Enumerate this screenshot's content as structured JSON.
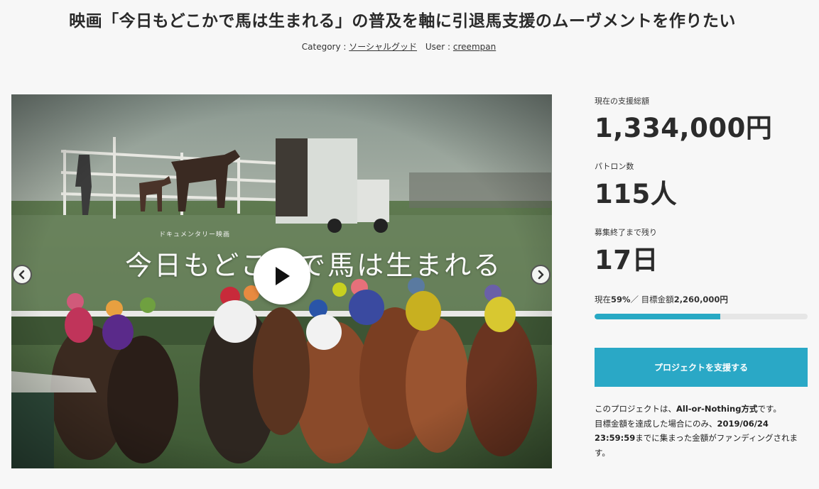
{
  "project": {
    "title": "映画「今日もどこかで馬は生まれる」の普及を軸に引退馬支援のムーヴメントを作りたい",
    "category_label": "Category :",
    "category_value": "ソーシャルグッド",
    "user_label": "User :",
    "user_value": "creempan"
  },
  "video": {
    "subtitle": "ドキュメンタリー映画",
    "title": "今日もどこかで馬は生まれる"
  },
  "stats": {
    "total_label": "現在の支援総額",
    "total_value": "1,334,000円",
    "patrons_label": "パトロン数",
    "patrons_value": "115人",
    "remaining_label": "募集終了まで残り",
    "remaining_value": "17日",
    "progress_prefix": "現在",
    "progress_percent": "59%",
    "progress_sep": "／ 目標金額",
    "goal_value": "2,260,000円",
    "progress_fraction": 0.59
  },
  "cta": {
    "label": "プロジェクトを支援する"
  },
  "note": {
    "line1_prefix": "このプロジェクトは、",
    "line1_bold": "All-or-Nothing方式",
    "line1_suffix": "です。",
    "line2_prefix": "目標金額を達成した場合にのみ、",
    "line2_bold": "2019/06/24",
    "line3_bold": "23:59:59",
    "line3_suffix": "までに集まった金額がファンディングされま",
    "line4": "す。"
  },
  "colors": {
    "accent": "#2aa8c6",
    "progress": "#28a9c4"
  },
  "icons": {
    "play": "play-icon",
    "prev": "chevron-left-icon",
    "next": "chevron-right-icon"
  }
}
